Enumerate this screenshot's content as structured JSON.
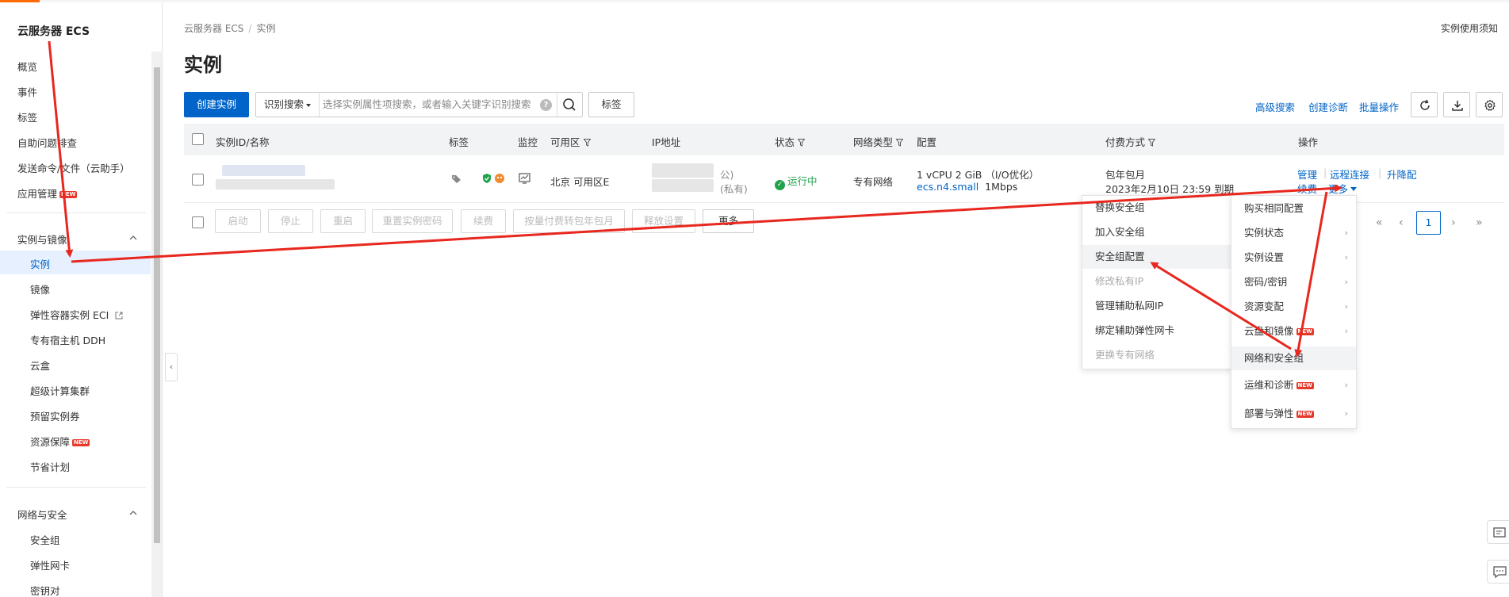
{
  "sidebar": {
    "title": "云服务器 ECS",
    "top_items": [
      "概览",
      "事件",
      "标签",
      "自助问题排查",
      "发送命令/文件（云助手）",
      "应用管理"
    ],
    "group1_title": "实例与镜像",
    "group1_items": [
      "实例",
      "镜像",
      "弹性容器实例 ECI",
      "专有宿主机 DDH",
      "云盒",
      "超级计算集群",
      "预留实例券",
      "资源保障",
      "节省计划"
    ],
    "group2_title": "网络与安全",
    "group2_items": [
      "安全组",
      "弹性网卡",
      "密钥对"
    ],
    "new_badge": "NEW"
  },
  "breadcrumb": {
    "root": "云服务器 ECS",
    "current": "实例"
  },
  "page": {
    "title": "实例",
    "help": "实例使用须知"
  },
  "toolbar": {
    "create": "创建实例",
    "search_mode": "识别搜索",
    "search_placeholder": "选择实例属性项搜索，或者输入关键字识别搜索",
    "search_help": "?",
    "tag": "标签",
    "advanced_search": "高级搜索",
    "create_diagnosis": "创建诊断",
    "batch_ops": "批量操作"
  },
  "table": {
    "headers": [
      "实例ID/名称",
      "标签",
      "监控",
      "可用区",
      "IP地址",
      "状态",
      "网络类型",
      "配置",
      "付费方式",
      "操作"
    ],
    "row": {
      "zone": "北京 可用区E",
      "ip_public_suffix": "公)",
      "ip_private_suffix": "(私有)",
      "status": "运行中",
      "network": "专有网络",
      "config_line1": "1 vCPU 2 GiB （I/O优化）",
      "config_spec": "ecs.n4.small",
      "config_bw": "1Mbps",
      "billing": "包年包月",
      "expire": "2023年2月10日 23:59 到期",
      "actions": [
        "管理",
        "远程连接",
        "升降配",
        "续费",
        "更多"
      ]
    }
  },
  "bulk_actions": [
    "启动",
    "停止",
    "重启",
    "重置实例密码",
    "续费",
    "按量付费转包年包月",
    "释放设置",
    "更多"
  ],
  "pagination": {
    "current": "1"
  },
  "more_menu": [
    {
      "label": "购买相同配置",
      "sub": false
    },
    {
      "label": "实例状态",
      "sub": true
    },
    {
      "label": "实例设置",
      "sub": true
    },
    {
      "label": "密码/密钥",
      "sub": true
    },
    {
      "label": "资源变配",
      "sub": true
    },
    {
      "label": "云盘和镜像",
      "sub": true,
      "new": true
    },
    {
      "label": "网络和安全组",
      "sub": false
    },
    {
      "label": "运维和诊断",
      "sub": true,
      "new": true
    },
    {
      "label": "部署与弹性",
      "sub": true,
      "new": true
    }
  ],
  "network_submenu": [
    {
      "label": "替换安全组",
      "disabled": false
    },
    {
      "label": "加入安全组",
      "disabled": false
    },
    {
      "label": "安全组配置",
      "disabled": false,
      "highlight": true
    },
    {
      "label": "修改私有IP",
      "disabled": true
    },
    {
      "label": "管理辅助私网IP",
      "disabled": false
    },
    {
      "label": "绑定辅助弹性网卡",
      "disabled": false
    },
    {
      "label": "更换专有网络",
      "disabled": true
    }
  ],
  "colors": {
    "primary": "#0064c8",
    "accent": "#ff6a00",
    "annotation": "#e8271e",
    "running": "#1fa34a"
  }
}
